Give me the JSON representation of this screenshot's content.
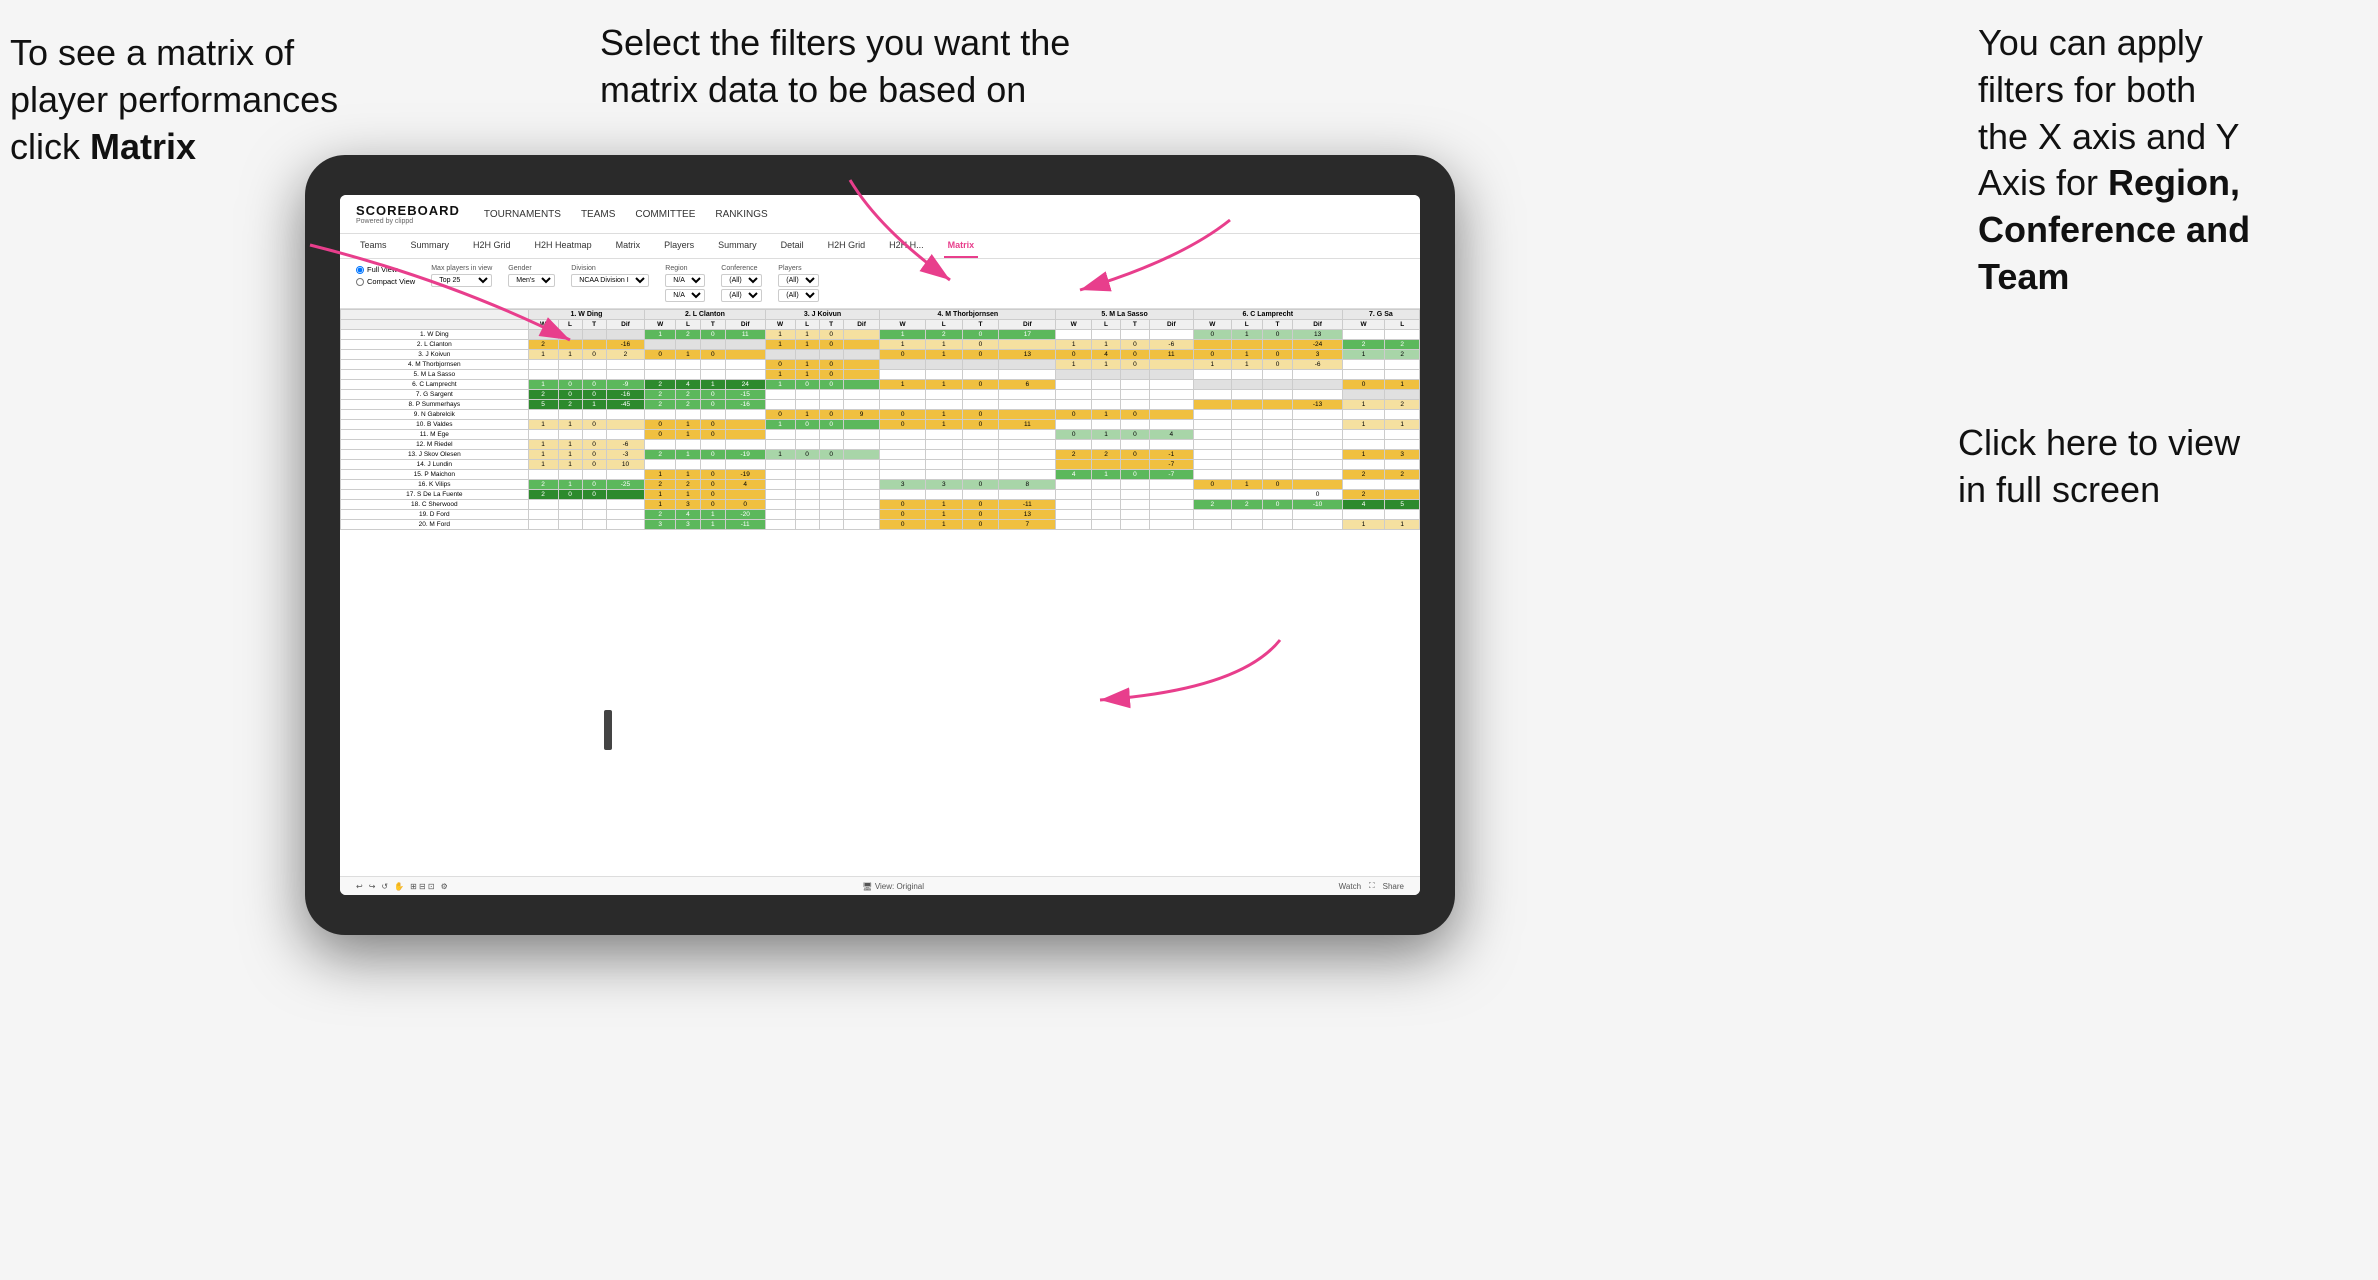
{
  "annotations": {
    "left": {
      "line1": "To see a matrix of",
      "line2": "player performances",
      "line3_prefix": "click ",
      "line3_bold": "Matrix"
    },
    "center": {
      "text": "Select the filters you want the matrix data to be based on"
    },
    "right": {
      "line1": "You  can apply",
      "line2": "filters for both",
      "line3": "the X axis and Y",
      "line4_prefix": "Axis for ",
      "line4_bold": "Region,",
      "line5_bold": "Conference and",
      "line6_bold": "Team"
    },
    "bottom_right": {
      "line1": "Click here to view",
      "line2": "in full screen"
    }
  },
  "scoreboard": {
    "logo_title": "SCOREBOARD",
    "logo_sub": "Powered by clippd",
    "nav_items": [
      "TOURNAMENTS",
      "TEAMS",
      "COMMITTEE",
      "RANKINGS"
    ]
  },
  "sub_tabs": [
    "Teams",
    "Summary",
    "H2H Grid",
    "H2H Heatmap",
    "Matrix",
    "Players",
    "Summary",
    "Detail",
    "H2H Grid",
    "H2H H...",
    "Matrix"
  ],
  "active_tab": "Matrix",
  "filters": {
    "view_options": [
      "Full View",
      "Compact View"
    ],
    "max_players_label": "Max players in view",
    "max_players_value": "Top 25",
    "gender_label": "Gender",
    "gender_value": "Men's",
    "division_label": "Division",
    "division_value": "NCAA Division I",
    "region_label": "Region",
    "region_value1": "N/A",
    "region_value2": "N/A",
    "conference_label": "Conference",
    "conference_value1": "(All)",
    "conference_value2": "(All)",
    "players_label": "Players",
    "players_value1": "(All)",
    "players_value2": "(All)"
  },
  "matrix": {
    "col_headers": [
      "1. W Ding",
      "2. L Clanton",
      "3. J Koivun",
      "4. M Thorbjornsen",
      "5. M La Sasso",
      "6. C Lamprecht",
      "7. G Sa"
    ],
    "sub_headers": [
      "W",
      "L",
      "T",
      "Dif"
    ],
    "rows": [
      {
        "name": "1. W Ding",
        "data": [
          [
            null,
            null,
            null,
            null
          ],
          [
            1,
            2,
            0,
            11
          ],
          [
            1,
            1,
            0,
            null
          ],
          [
            1,
            2,
            0,
            17
          ],
          [
            null,
            null,
            null,
            null
          ],
          [
            0,
            1,
            0,
            13
          ],
          [
            null,
            null
          ]
        ]
      },
      {
        "name": "2. L Clanton",
        "data": [
          [
            2,
            null,
            null,
            -16
          ],
          [
            null,
            null,
            null,
            null
          ],
          [
            1,
            1,
            0,
            null
          ],
          [
            1,
            1,
            0,
            null
          ],
          [
            1,
            1,
            0,
            -6
          ],
          [
            null,
            null,
            null,
            -24
          ],
          [
            2,
            2
          ]
        ]
      },
      {
        "name": "3. J Koivun",
        "data": [
          [
            1,
            1,
            0,
            2
          ],
          [
            0,
            1,
            0,
            null
          ],
          [
            null,
            null,
            null,
            null
          ],
          [
            0,
            1,
            0,
            13
          ],
          [
            0,
            4,
            0,
            11
          ],
          [
            0,
            1,
            0,
            3
          ],
          [
            1,
            2
          ]
        ]
      },
      {
        "name": "4. M Thorbjornsen",
        "data": [
          [
            null,
            null,
            null,
            null
          ],
          [
            null,
            null,
            null,
            null
          ],
          [
            0,
            1,
            0,
            null
          ],
          [
            null,
            null,
            null,
            null
          ],
          [
            1,
            1,
            0,
            null
          ],
          [
            1,
            1,
            0,
            -6
          ],
          [
            null,
            null
          ]
        ]
      },
      {
        "name": "5. M La Sasso",
        "data": [
          [
            null,
            null,
            null,
            null
          ],
          [
            null,
            null,
            null,
            null
          ],
          [
            1,
            1,
            0,
            null
          ],
          [
            null,
            null,
            null,
            null
          ],
          [
            null,
            null,
            null,
            null
          ],
          [
            null,
            null,
            null,
            null
          ],
          [
            null,
            null
          ]
        ]
      },
      {
        "name": "6. C Lamprecht",
        "data": [
          [
            1,
            0,
            0,
            -9
          ],
          [
            2,
            4,
            1,
            24
          ],
          [
            1,
            0,
            0,
            null
          ],
          [
            1,
            1,
            0,
            6
          ],
          [
            null,
            null,
            null,
            null
          ],
          [
            null,
            null,
            null,
            null
          ],
          [
            0,
            1
          ]
        ]
      },
      {
        "name": "7. G Sargent",
        "data": [
          [
            2,
            0,
            0,
            -16
          ],
          [
            2,
            2,
            0,
            -15
          ],
          [
            null,
            null,
            null,
            null
          ],
          [
            null,
            null,
            null,
            null
          ],
          [
            null,
            null,
            null,
            null
          ],
          [
            null,
            null,
            null,
            null
          ],
          [
            null,
            null
          ]
        ]
      },
      {
        "name": "8. P Summerhays",
        "data": [
          [
            5,
            2,
            1,
            -45
          ],
          [
            2,
            2,
            0,
            -16
          ],
          [
            null,
            null,
            null,
            null
          ],
          [
            null,
            null,
            null,
            null
          ],
          [
            null,
            null,
            null,
            null
          ],
          [
            null,
            null,
            null,
            -13
          ],
          [
            1,
            2
          ]
        ]
      },
      {
        "name": "9. N Gabrelcik",
        "data": [
          [
            null,
            null,
            null,
            null
          ],
          [
            null,
            null,
            null,
            null
          ],
          [
            0,
            1,
            0,
            9
          ],
          [
            0,
            1,
            0,
            null
          ],
          [
            0,
            1,
            0,
            null
          ],
          [
            null,
            null,
            null,
            null
          ],
          [
            null,
            null
          ]
        ]
      },
      {
        "name": "10. B Valdes",
        "data": [
          [
            1,
            1,
            0,
            null
          ],
          [
            0,
            1,
            0,
            null
          ],
          [
            1,
            0,
            0,
            null
          ],
          [
            0,
            1,
            0,
            11
          ],
          [
            null,
            null,
            null,
            null
          ],
          [
            null,
            null,
            null,
            null
          ],
          [
            1,
            1
          ]
        ]
      },
      {
        "name": "11. M Ege",
        "data": [
          [
            null,
            null,
            null,
            null
          ],
          [
            0,
            1,
            0,
            null
          ],
          [
            null,
            null,
            null,
            null
          ],
          [
            null,
            null,
            null,
            null
          ],
          [
            0,
            1,
            0,
            4
          ],
          [
            null,
            null,
            null,
            null
          ],
          [
            null,
            null
          ]
        ]
      },
      {
        "name": "12. M Riedel",
        "data": [
          [
            1,
            1,
            0,
            -6
          ],
          [
            null,
            null,
            null,
            null
          ],
          [
            null,
            null,
            null,
            null
          ],
          [
            null,
            null,
            null,
            null
          ],
          [
            null,
            null,
            null,
            null
          ],
          [
            null,
            null,
            null,
            null
          ],
          [
            null,
            null
          ]
        ]
      },
      {
        "name": "13. J Skov Olesen",
        "data": [
          [
            1,
            1,
            0,
            -3
          ],
          [
            2,
            1,
            0,
            -19
          ],
          [
            1,
            0,
            0,
            null
          ],
          [
            null,
            null,
            null,
            null
          ],
          [
            2,
            2,
            0,
            -1
          ],
          [
            null,
            null,
            null,
            null
          ],
          [
            1,
            3
          ]
        ]
      },
      {
        "name": "14. J Lundin",
        "data": [
          [
            1,
            1,
            0,
            10
          ],
          [
            null,
            null,
            null,
            null
          ],
          [
            null,
            null,
            null,
            null
          ],
          [
            null,
            null,
            null,
            null
          ],
          [
            null,
            null,
            null,
            -7
          ],
          [
            null,
            null,
            null,
            null
          ],
          [
            null,
            null
          ]
        ]
      },
      {
        "name": "15. P Maichon",
        "data": [
          [
            null,
            null,
            null,
            null
          ],
          [
            1,
            1,
            0,
            -19
          ],
          [
            null,
            null,
            null,
            null
          ],
          [
            null,
            null,
            null,
            null
          ],
          [
            4,
            1,
            0,
            -7
          ],
          [
            null,
            null,
            null,
            null
          ],
          [
            2,
            2
          ]
        ]
      },
      {
        "name": "16. K Vilips",
        "data": [
          [
            2,
            1,
            0,
            -25
          ],
          [
            2,
            2,
            0,
            4
          ],
          [
            null,
            null,
            null,
            null
          ],
          [
            3,
            3,
            0,
            8
          ],
          [
            null,
            null,
            null,
            null
          ],
          [
            0,
            1,
            0,
            null
          ],
          [
            null,
            null
          ]
        ]
      },
      {
        "name": "17. S De La Fuente",
        "data": [
          [
            2,
            0,
            0,
            null
          ],
          [
            1,
            1,
            0,
            null
          ],
          [
            null,
            null,
            null,
            null
          ],
          [
            null,
            null,
            null,
            null
          ],
          [
            null,
            null,
            null,
            null
          ],
          [
            null,
            null,
            null,
            null
          ],
          [
            0,
            2
          ]
        ]
      },
      {
        "name": "18. C Sherwood",
        "data": [
          [
            null,
            null,
            null,
            null
          ],
          [
            1,
            3,
            0,
            0
          ],
          [
            null,
            null,
            null,
            null
          ],
          [
            0,
            1,
            0,
            -11
          ],
          [
            null,
            null,
            null,
            null
          ],
          [
            2,
            2,
            0,
            -10
          ],
          [
            4,
            5
          ]
        ]
      },
      {
        "name": "19. D Ford",
        "data": [
          [
            null,
            null,
            null,
            null
          ],
          [
            2,
            4,
            1,
            -20
          ],
          [
            null,
            null,
            null,
            null
          ],
          [
            0,
            1,
            0,
            13
          ],
          [
            null,
            null,
            null,
            null
          ],
          [
            null,
            null,
            null,
            null
          ],
          [
            null,
            null
          ]
        ]
      },
      {
        "name": "20. M Ford",
        "data": [
          [
            null,
            null,
            null,
            null
          ],
          [
            3,
            3,
            1,
            -11
          ],
          [
            null,
            null,
            null,
            null
          ],
          [
            0,
            1,
            0,
            7
          ],
          [
            null,
            null,
            null,
            null
          ],
          [
            null,
            null,
            null,
            null
          ],
          [
            1,
            1
          ]
        ]
      }
    ]
  },
  "bottom_bar": {
    "view_original": "View: Original",
    "watch": "Watch",
    "share": "Share"
  }
}
